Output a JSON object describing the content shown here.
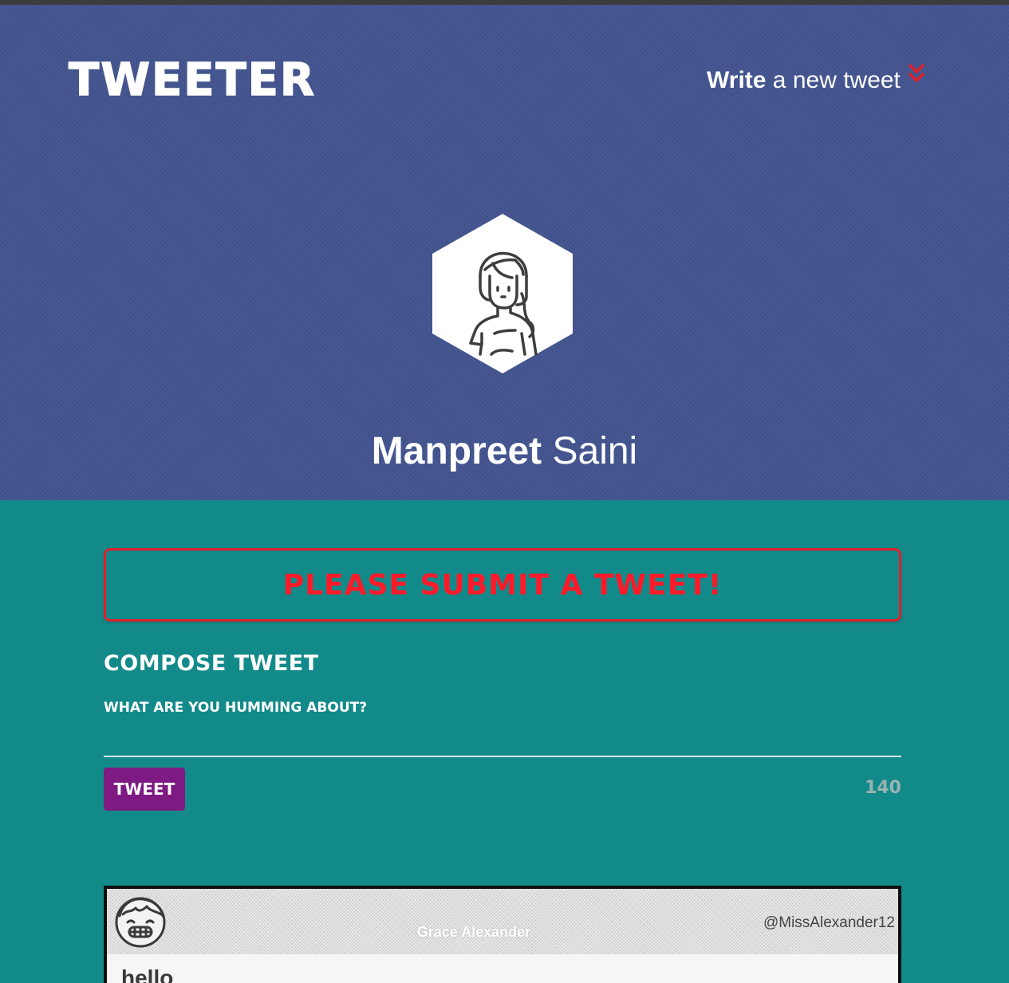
{
  "header": {
    "brand": "Tweeter",
    "compose_link_bold": "Write",
    "compose_link_rest": " a new tweet",
    "compose_link_icon": "double-chevron-down-icon"
  },
  "profile": {
    "first_name": "Manpreet",
    "last_name": "Saini",
    "avatar_icon": "woman-avatar-icon"
  },
  "error": {
    "message": "Please submit a tweet!"
  },
  "compose": {
    "title": "Compose Tweet",
    "placeholder": "What are you humming about?",
    "submit_label": "Tweet",
    "char_count": "140"
  },
  "tweets": [
    {
      "author": "Grace Alexander",
      "handle": "@MissAlexander12",
      "content": "hello",
      "avatar_icon": "grinning-boy-avatar-icon"
    }
  ],
  "colors": {
    "header_bg": "#43548f",
    "page_bg": "#138a8a",
    "error": "#ff1a2a",
    "button": "#7e1b82"
  }
}
